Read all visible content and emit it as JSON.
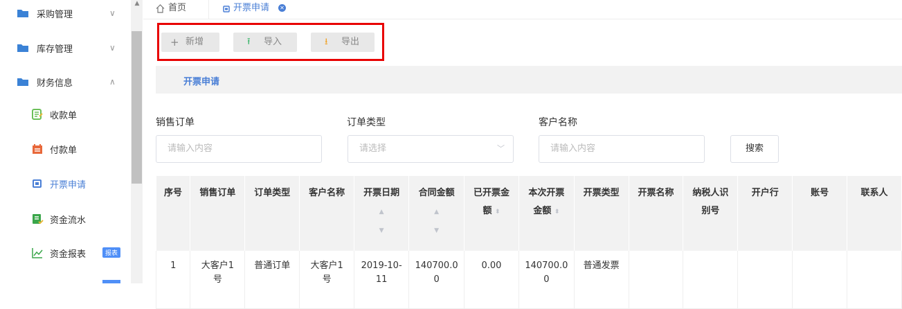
{
  "sidebar": {
    "menus": [
      {
        "label": "采购管理",
        "chevron": "∨"
      },
      {
        "label": "库存管理",
        "chevron": "∨"
      },
      {
        "label": "财务信息",
        "chevron": "∧"
      }
    ],
    "sub_items": [
      {
        "label": "收款单",
        "icon": "receipt-icon",
        "color": "#6bbf59"
      },
      {
        "label": "付款单",
        "icon": "payment-icon",
        "color": "#e8683a"
      },
      {
        "label": "开票申请",
        "icon": "invoice-icon",
        "color": "#4a7fd6"
      },
      {
        "label": "资金流水",
        "icon": "cashflow-icon",
        "color": "#3aa64a"
      },
      {
        "label": "资金报表",
        "icon": "chart-line-icon",
        "color": "#3aa64a",
        "badge": "报表"
      }
    ]
  },
  "tabs": {
    "home": "首页",
    "active": "开票申请"
  },
  "toolbar": {
    "add": "新增",
    "import": "导入",
    "export": "导出"
  },
  "panel": {
    "title": "开票申请"
  },
  "filters": {
    "sales_order": {
      "label": "销售订单",
      "placeholder": "请输入内容"
    },
    "order_type": {
      "label": "订单类型",
      "placeholder": "请选择"
    },
    "customer": {
      "label": "客户名称",
      "placeholder": "请输入内容"
    },
    "search_btn": "搜索"
  },
  "table": {
    "headers": [
      {
        "l1": "序号",
        "l2": ""
      },
      {
        "l1": "销售订单",
        "l2": ""
      },
      {
        "l1": "订单类型",
        "l2": ""
      },
      {
        "l1": "客户名称",
        "l2": ""
      },
      {
        "l1": "开票日期",
        "l2": ""
      },
      {
        "l1": "合同金额",
        "l2": ""
      },
      {
        "l1": "已开票金",
        "l2": "额"
      },
      {
        "l1": "本次开票",
        "l2": "金额"
      },
      {
        "l1": "开票类型",
        "l2": ""
      },
      {
        "l1": "开票名称",
        "l2": ""
      },
      {
        "l1": "纳税人识",
        "l2": "别号"
      },
      {
        "l1": "开户行",
        "l2": ""
      },
      {
        "l1": "账号",
        "l2": ""
      },
      {
        "l1": "联系人",
        "l2": ""
      }
    ],
    "rows": [
      [
        "1",
        "大客户1\n号",
        "普通订单",
        "大客户1\n号",
        "2019-10-\n11",
        "140700.0\n0",
        "0.00",
        "140700.0\n0",
        "普通发票",
        "",
        "",
        "",
        "",
        ""
      ]
    ]
  },
  "colors": {
    "accent": "#4a7fd6",
    "highlight_border": "#e80000"
  }
}
